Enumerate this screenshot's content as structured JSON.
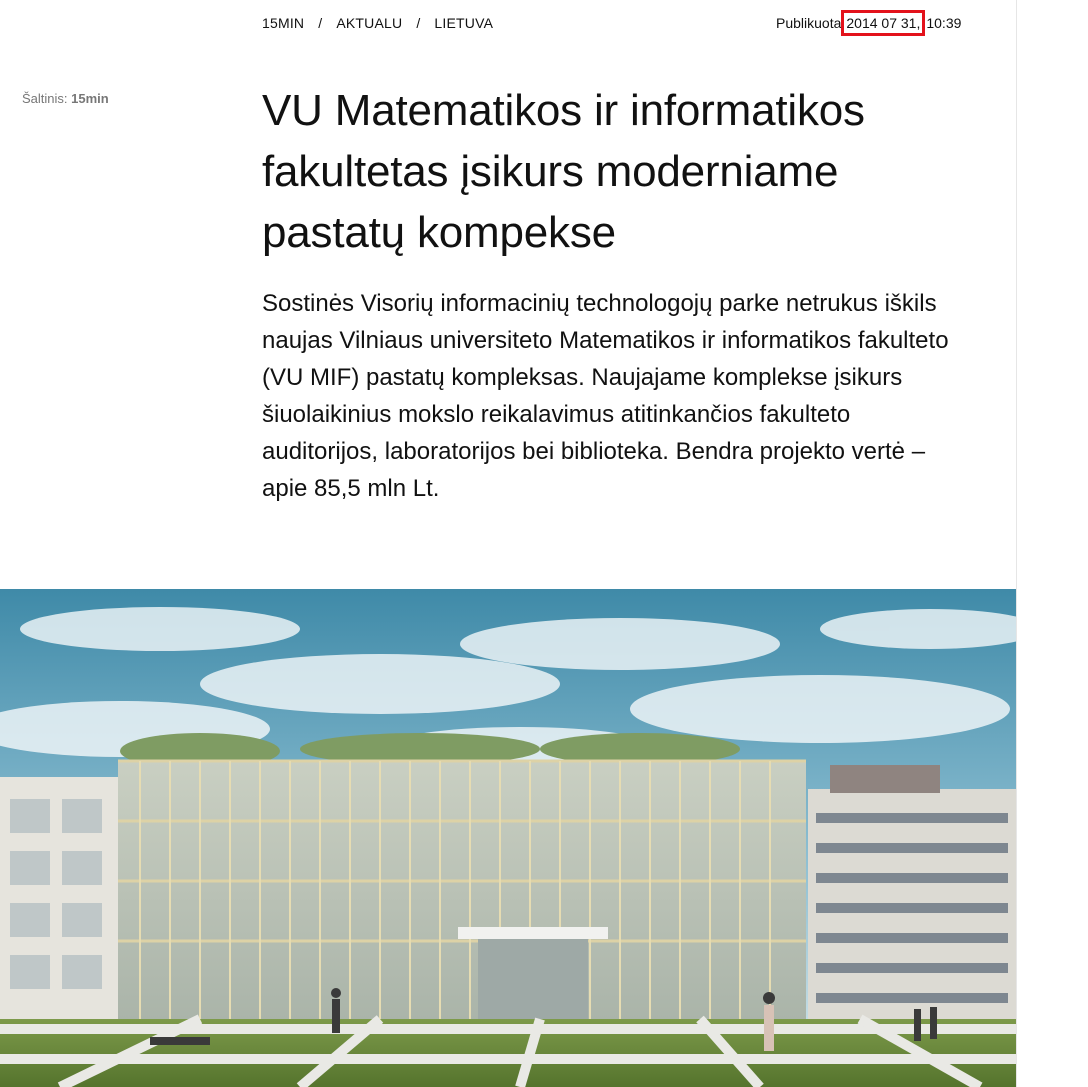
{
  "breadcrumb": [
    {
      "label": "15MIN"
    },
    {
      "label": "AKTUALU"
    },
    {
      "label": "LIETUVA"
    }
  ],
  "breadcrumb_separator": "/",
  "published": {
    "label": "Publikuota",
    "date": "2014 07 31,",
    "time": "10:39",
    "highlight_color": "#e3121b"
  },
  "source": {
    "label": "Šaltinis:",
    "name": "15min"
  },
  "article": {
    "title": "VU Matematikos ir informatikos fakultetas įsikurs moderniame pastatų kompekse",
    "lead": "Sostinės Visorių informacinių technologojų parke netrukus iškils naujas Vilniaus universiteto Matematikos ir informatikos fakulteto (VU MIF) pastatų kompleksas. Naujajame komplekse įsikurs šiuolaikinius mokslo reikalavimus atitinkančios fakulteto auditorijos, laboratorijos bei biblioteka. Bendra projekto vertė – apie 85,5 mln Lt."
  }
}
